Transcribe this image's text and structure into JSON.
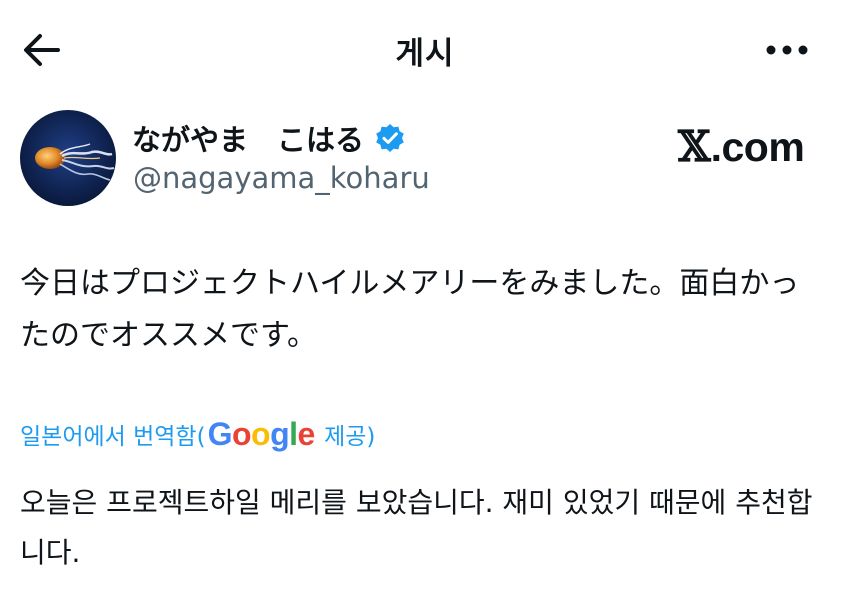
{
  "header": {
    "title": "게시",
    "back_icon": "arrow-left-icon",
    "more_icon": "more-horizontal-icon"
  },
  "author": {
    "display_name": "ながやま　こはる",
    "handle": "@nagayama_koharu",
    "verified_icon": "verified-badge-icon",
    "avatar_icon": "jellyfish-avatar"
  },
  "brand": {
    "x_letter": "𝕏",
    "domain": ".com"
  },
  "post": {
    "text": "今日はプロジェクトハイルメアリーをみました。面白かったのでオススメです。"
  },
  "translation": {
    "label_prefix": "일본어에서 번역함(",
    "provider_letters": [
      "G",
      "o",
      "o",
      "g",
      "l",
      "e"
    ],
    "label_suffix": " 제공)",
    "text": "오늘은 프로젝트하일 메리를 보았습니다. 재미 있었기 때문에 추천합니다."
  },
  "colors": {
    "text": "#0f1419",
    "secondary": "#536471",
    "link": "#1d9bf0",
    "verified": "#1d9bf0",
    "google": [
      "#4285F4",
      "#EA4335",
      "#FBBC05",
      "#4285F4",
      "#34A853",
      "#EA4335"
    ]
  }
}
